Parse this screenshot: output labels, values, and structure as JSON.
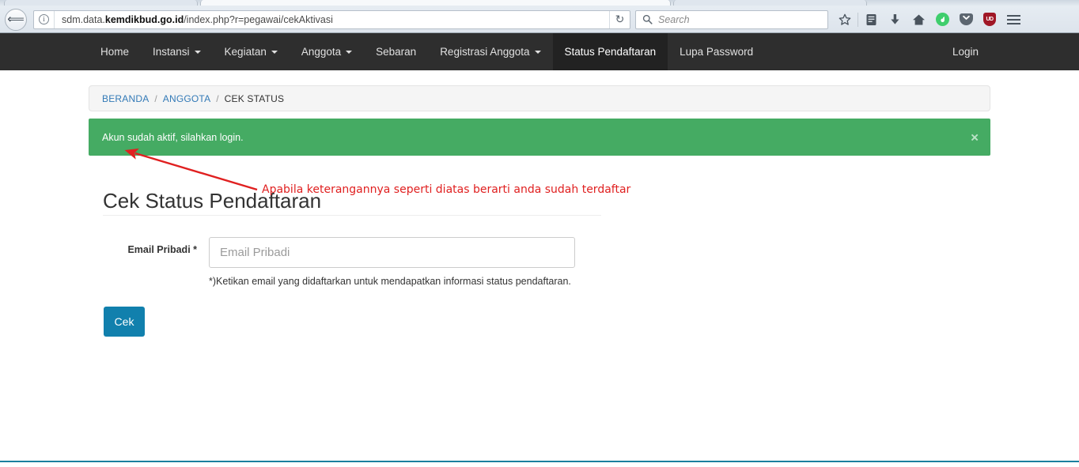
{
  "browser": {
    "back_icon": "back-arrow-icon",
    "identity_icon": "info-icon",
    "url_prefix": "sdm.data.",
    "url_domain": "kemdikbud.go.id",
    "url_suffix": "/index.php?r=pegawai/cekAktivasi",
    "reload_icon": "reload-icon",
    "search_placeholder": "Search",
    "search_icon": "search-icon",
    "toolbar_icons": [
      "star-bookmark-icon",
      "library-icon",
      "download-arrow-icon",
      "home-icon",
      "green-circle-addon-icon",
      "pocket-shield-icon",
      "ublock-origin-icon",
      "hamburger-menu-icon"
    ],
    "ublock_label": "UD"
  },
  "site_nav": {
    "items": [
      {
        "label": "Home",
        "caret": false,
        "active": false
      },
      {
        "label": "Instansi",
        "caret": true,
        "active": false
      },
      {
        "label": "Kegiatan",
        "caret": true,
        "active": false
      },
      {
        "label": "Anggota",
        "caret": true,
        "active": false
      },
      {
        "label": "Sebaran",
        "caret": false,
        "active": false
      },
      {
        "label": "Registrasi Anggota",
        "caret": true,
        "active": false
      },
      {
        "label": "Status Pendaftaran",
        "caret": false,
        "active": true
      },
      {
        "label": "Lupa Password",
        "caret": false,
        "active": false
      }
    ],
    "login_label": "Login"
  },
  "breadcrumb": {
    "items": [
      "BERANDA",
      "ANGGOTA",
      "CEK STATUS"
    ],
    "separator": "/"
  },
  "alert": {
    "message": "Akun sudah aktif, silahkan login.",
    "close_label": "×",
    "color": "#45ab63"
  },
  "main": {
    "title": "Cek Status Pendaftaran",
    "form": {
      "email_label": "Email Pribadi *",
      "email_value": "",
      "email_placeholder": "Email Pribadi",
      "help_text": "*)Ketikan email yang didaftarkan untuk mendapatkan informasi status pendaftaran."
    },
    "submit_label": "Cek",
    "submit_color": "#1180ad"
  },
  "annotation": {
    "text": "Apabila keterangannya seperti diatas berarti anda sudah terdaftar",
    "color": "#e02020",
    "arrow": "red-arrow-annotation"
  },
  "footer": {
    "rule_color": "#1b7f9e"
  }
}
